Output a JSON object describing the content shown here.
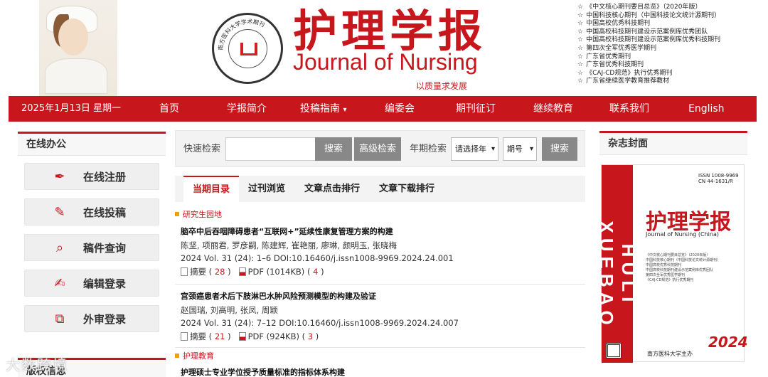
{
  "header": {
    "title_cn": "护理学报",
    "title_en": "Journal of Nursing",
    "slogan": "以质量求发展",
    "logo_text": "南方医科大学学术期刊",
    "honors": [
      "《中文核心期刊要目总览》（2020年版）",
      "中国科技核心期刊（中国科技论文统计源期刊）",
      "中国高校优秀科技期刊",
      "中国高校科技期刊建设示范案例库优秀团队",
      "中国高校科技期刊建设示范案例库优秀科技期刊",
      "第四次全军优秀医学期刊",
      "广东省优秀期刊",
      "广东省优秀科技期刊",
      "《CAJ-CD规范》执行优秀期刊",
      "广东省继续医学教育推荐教材"
    ],
    "star": "☆"
  },
  "nav": {
    "date": "2025年1月13日 星期一",
    "items": [
      "首页",
      "学报简介",
      "投稿指南",
      "编委会",
      "期刊征订",
      "继续教育",
      "联系我们",
      "English"
    ],
    "dropdown_marker": "▾"
  },
  "left": {
    "title": "在线办公",
    "buttons": [
      {
        "label": "在线注册",
        "icon": "quill-pen-icon"
      },
      {
        "label": "在线投稿",
        "icon": "submit-document-icon"
      },
      {
        "label": "稿件查询",
        "icon": "search-document-icon"
      },
      {
        "label": "编辑登录",
        "icon": "edit-icon"
      },
      {
        "label": "外审登录",
        "icon": "review-login-icon"
      }
    ],
    "footer_title": "版权信息"
  },
  "search": {
    "quick_label": "快速检索",
    "quick_placeholder": "",
    "search_button": "搜索",
    "advanced_button": "高级检索",
    "year_label": "年期检索",
    "year_select": "请选择年",
    "issue_select": "期号",
    "year_search_button": "搜索"
  },
  "tabs": [
    "当期目录",
    "过刊浏览",
    "文章点击排行",
    "文章下载排行"
  ],
  "sections": [
    {
      "name": "研究生园地",
      "articles": [
        {
          "title": "脑卒中后吞咽障碍患者“互联网+”延续性康复管理方案的构建",
          "authors": "陈坚, 项丽君, 罗彦嗣, 陈建辉, 崔艳丽, 廖琳, 颜明玉, 张晓梅",
          "citation": "2024 Vol. 31 (24): 1–6    DOI:10.16460/j.issn1008-9969.2024.24.001",
          "abstract_label": "摘要",
          "abstract_count": "28",
          "pdf_label": "PDF",
          "pdf_size": "(1014KB)",
          "pdf_count": "4"
        },
        {
          "title": "宫颈癌患者术后下肢淋巴水肿风险预测模型的构建及验证",
          "authors": "赵国瑞, 刘高明, 张凤, 周颖",
          "citation": "2024 Vol. 31 (24): 7–12    DOI:10.16460/j.issn1008-9969.2024.24.007",
          "abstract_label": "摘要",
          "abstract_count": "21",
          "pdf_label": "PDF",
          "pdf_size": "(924KB)",
          "pdf_count": "3"
        }
      ]
    },
    {
      "name": "护理教育",
      "articles": [
        {
          "title": "护理硕士专业学位授予质量标准的指标体系构建"
        }
      ]
    }
  ],
  "right": {
    "title": "杂志封面",
    "cover": {
      "spine": "HULI XUEBAO",
      "title": "护理学报",
      "subtitle": "Journal of Nursing (China)",
      "issn": "ISSN 1008-9969",
      "cn": "CN 44-1631/R",
      "number": "2024",
      "publisher": "南方医科大学主办"
    }
  },
  "watermark": "大数跨境"
}
